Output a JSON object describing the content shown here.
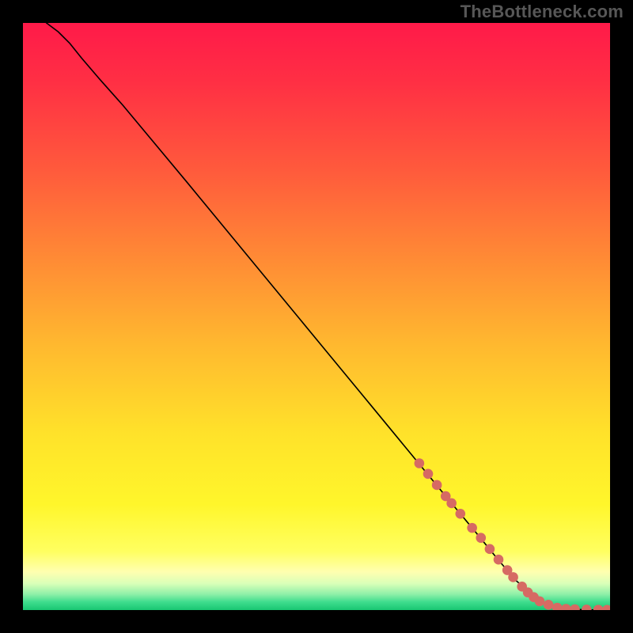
{
  "watermark": "TheBottleneck.com",
  "colors": {
    "dot_fill": "#d66a63",
    "line": "#000000"
  },
  "chart_data": {
    "type": "line",
    "title": "",
    "xlabel": "",
    "ylabel": "",
    "xlim": [
      0,
      100
    ],
    "ylim": [
      0,
      100
    ],
    "series": [
      {
        "name": "curve",
        "x": [
          4,
          6,
          8,
          10,
          13,
          17,
          22,
          28,
          35,
          43,
          51,
          59,
          66,
          72,
          77,
          81,
          84,
          87,
          89,
          92,
          96,
          100
        ],
        "y": [
          100,
          98.5,
          96.5,
          94,
          90.5,
          86,
          80,
          72.8,
          64.3,
          54.6,
          44.9,
          35.2,
          26.7,
          19.4,
          13.4,
          8.5,
          5,
          2.5,
          1,
          0.2,
          0.05,
          0
        ]
      }
    ],
    "highlight_points": {
      "name": "dots",
      "x": [
        67.5,
        69,
        70.5,
        72,
        73,
        74.5,
        76.5,
        78,
        79.5,
        81,
        82.5,
        83.5,
        85,
        86,
        87,
        88,
        89.5,
        91,
        92.5,
        94,
        96,
        98,
        99.5
      ],
      "y": [
        25,
        23.2,
        21.3,
        19.4,
        18.2,
        16.4,
        14,
        12.3,
        10.4,
        8.6,
        6.8,
        5.6,
        4,
        3,
        2.2,
        1.5,
        0.9,
        0.4,
        0.2,
        0.12,
        0.08,
        0.05,
        0.03
      ]
    }
  }
}
